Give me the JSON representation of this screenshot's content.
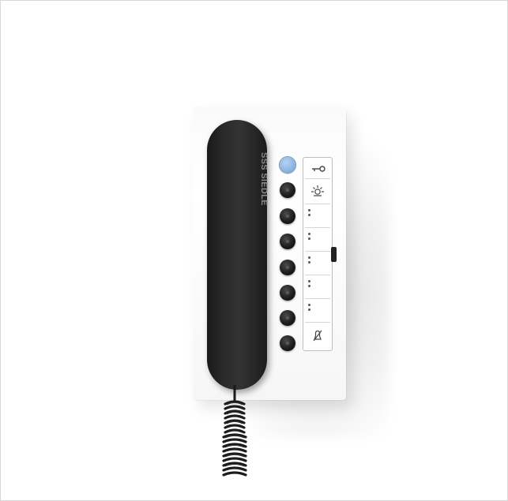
{
  "image": {
    "description_colors": {
      "background": "#ffffff",
      "plate": "#f9f9f9",
      "handset": "#1f1f1f",
      "accent_button": "#8db5e2"
    }
  },
  "device": {
    "brand": "SSS SIEDLE"
  },
  "buttons": [
    {
      "name": "blue-button"
    },
    {
      "name": "key-button"
    },
    {
      "name": "light-button"
    },
    {
      "name": "call-button-1"
    },
    {
      "name": "call-button-2"
    },
    {
      "name": "call-button-3"
    },
    {
      "name": "call-button-4"
    },
    {
      "name": "call-button-5"
    },
    {
      "name": "mute-button"
    }
  ],
  "labels": {
    "key_icon": "key-icon",
    "light_icon": "light-icon",
    "bell_icon": "bell-off-icon"
  }
}
